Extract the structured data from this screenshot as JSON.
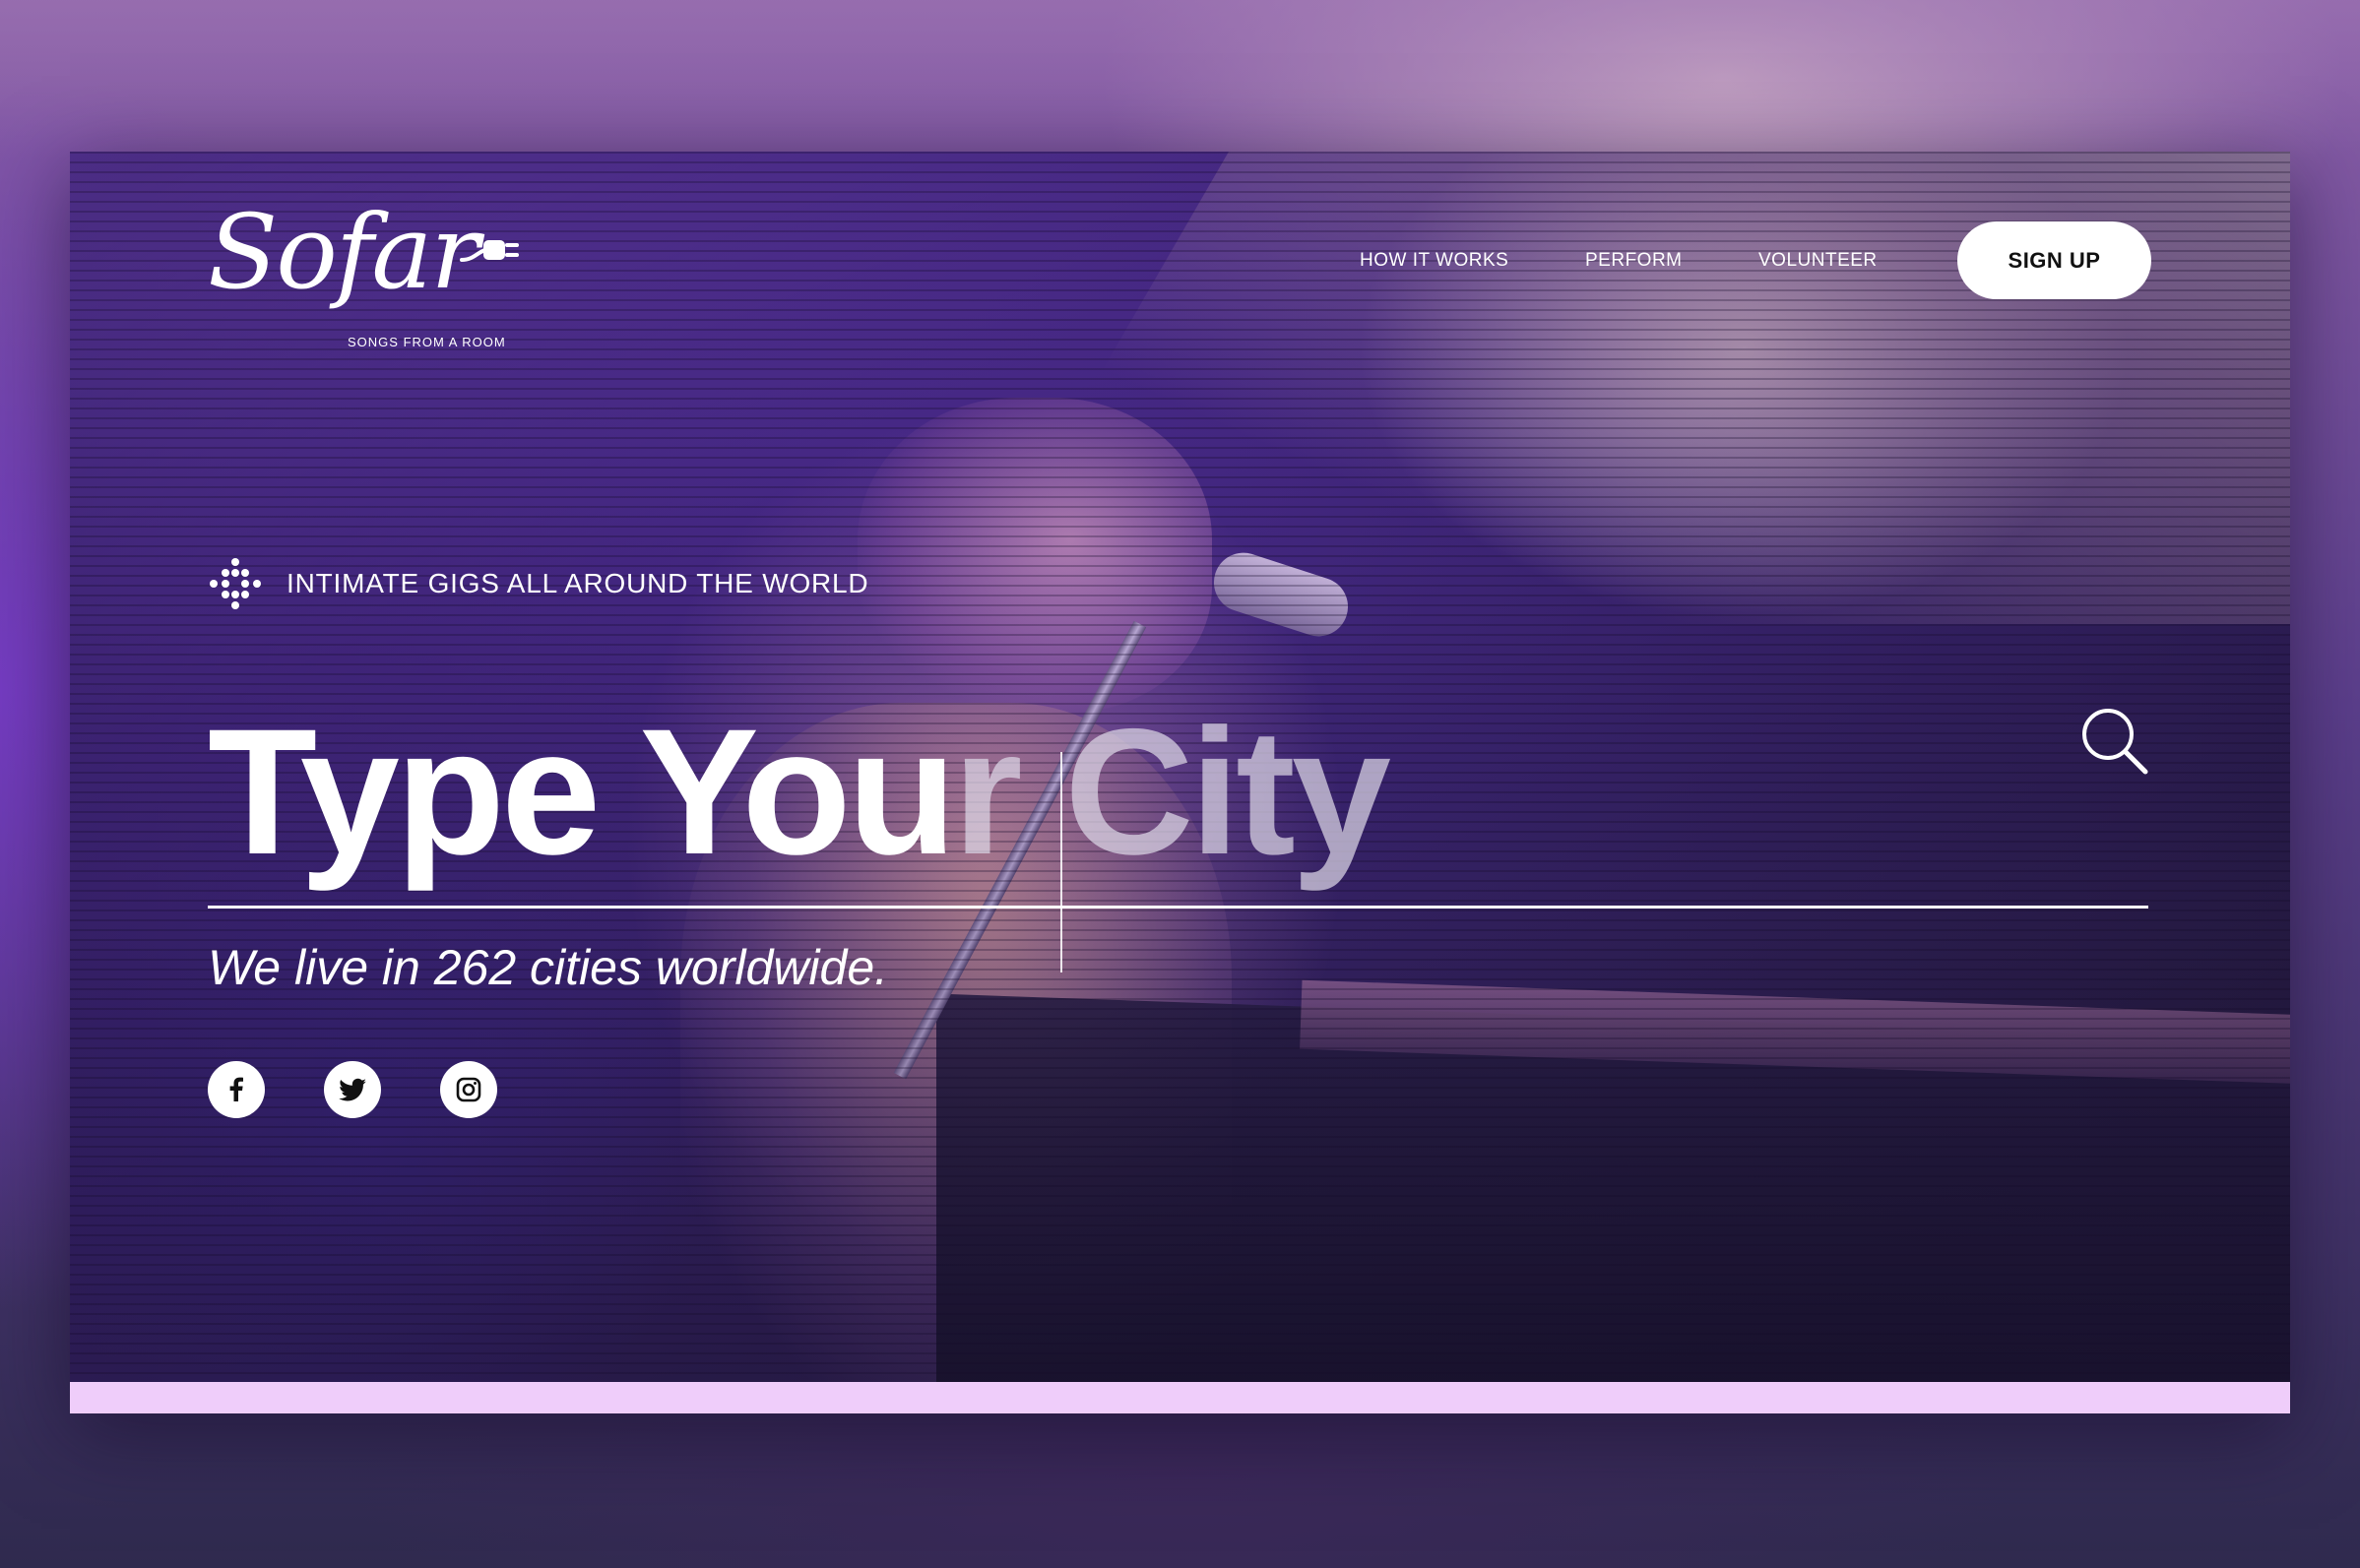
{
  "brand": {
    "logo_text": "Sofar",
    "logo_tagline": "SONGS FROM A ROOM"
  },
  "nav": {
    "items": [
      {
        "label": "HOW IT WORKS"
      },
      {
        "label": "PERFORM"
      },
      {
        "label": "VOLUNTEER"
      }
    ],
    "signup_label": "SIGN UP"
  },
  "hero": {
    "tagline": "INTIMATE GIGS ALL AROUND THE WORLD",
    "search": {
      "typed_text": "Type You",
      "placeholder_rest": "r City",
      "placeholder": "Type Your City"
    },
    "subtitle": "We live in 262 cities worldwide."
  },
  "social": {
    "items": [
      {
        "icon": "facebook-icon"
      },
      {
        "icon": "twitter-icon"
      },
      {
        "icon": "instagram-icon"
      }
    ]
  },
  "colors": {
    "accent_strip": "#efcdfa",
    "hero_purple": "#4b2b8f",
    "button_bg": "#ffffff"
  }
}
